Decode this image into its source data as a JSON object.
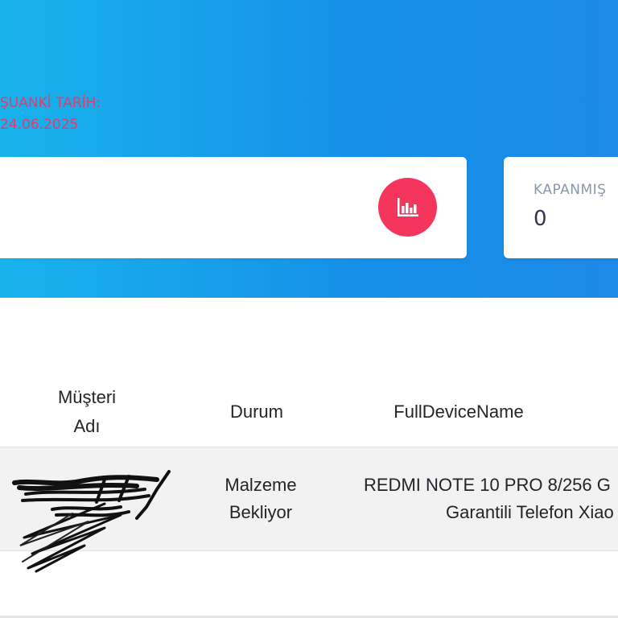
{
  "header": {
    "date_label": "ŞUANKİ TARİH:",
    "date_value": "24.06.2025"
  },
  "stats": {
    "closed_title": "KAPANMIŞ",
    "closed_value": "0"
  },
  "table": {
    "headers": {
      "musteri_adi_line1": "Müşteri",
      "musteri_adi_line2": "Adı",
      "durum": "Durum",
      "full_device_name": "FullDeviceName"
    },
    "rows": [
      {
        "durum": "Malzeme Bekliyor",
        "device_line1": "REDMI NOTE 10 PRO 8/256 G",
        "device_line2": "Garantili Telefon Xiao"
      }
    ]
  },
  "icons": {
    "stat": "bar-chart-icon"
  },
  "colors": {
    "hero_start": "#18b3ec",
    "hero_end": "#1c8ae6",
    "accent_red": "#f5365c",
    "date_text": "#e63a6b"
  }
}
